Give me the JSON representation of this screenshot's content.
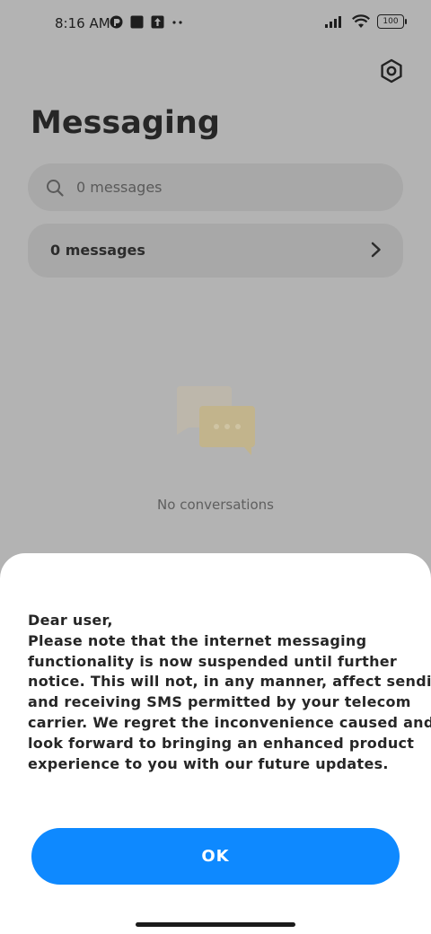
{
  "status_bar": {
    "time": "8:16 AM",
    "battery": "100"
  },
  "header": {
    "title": "Messaging",
    "settings_icon": "gear-icon"
  },
  "search": {
    "placeholder": "0 messages"
  },
  "summary": {
    "label": "0 messages"
  },
  "empty_state": {
    "text": "No conversations"
  },
  "dialog": {
    "lines": [
      "Dear user,",
      "Please note that the internet messaging",
      "functionality is now suspended until further",
      "notice. This will not, in any manner, affect sending",
      "and receiving SMS permitted by your telecom",
      "carrier. We regret the inconvenience caused and",
      "look forward to bringing an enhanced product",
      "experience to you with our future updates."
    ],
    "ok_label": "OK"
  },
  "colors": {
    "accent": "#0e89ff",
    "scrim": "#b3b3b3",
    "sheet": "#ffffff"
  }
}
